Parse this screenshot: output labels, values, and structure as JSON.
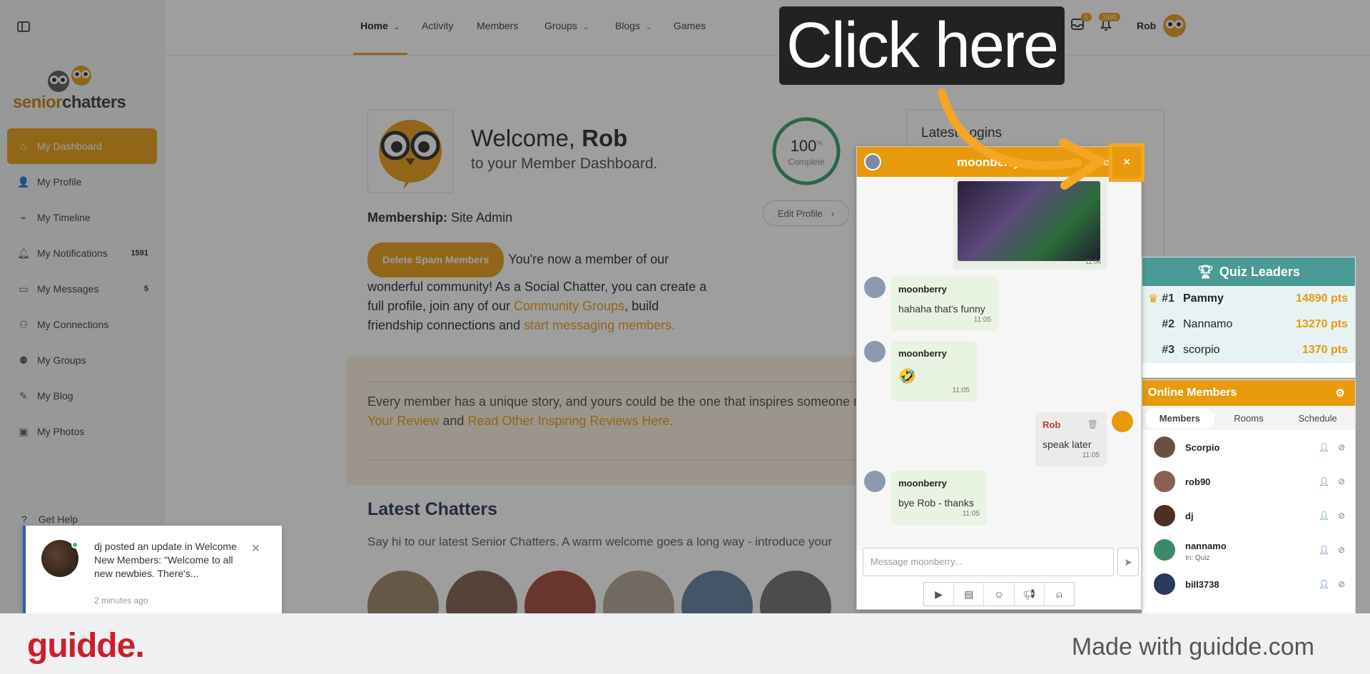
{
  "sidebar": {
    "brand_part1": "senior",
    "brand_part2": "chatters",
    "items": [
      {
        "label": "My Dashboard",
        "icon": "home-icon",
        "count": ""
      },
      {
        "label": "My Profile",
        "icon": "user-icon",
        "count": ""
      },
      {
        "label": "My Timeline",
        "icon": "timeline-icon",
        "count": ""
      },
      {
        "label": "My Notifications",
        "icon": "bell-icon",
        "count": "1591"
      },
      {
        "label": "My Messages",
        "icon": "inbox-icon",
        "count": "5"
      },
      {
        "label": "My Connections",
        "icon": "connections-icon",
        "count": ""
      },
      {
        "label": "My Groups",
        "icon": "groups-icon",
        "count": ""
      },
      {
        "label": "My Blog",
        "icon": "pencil-icon",
        "count": ""
      },
      {
        "label": "My Photos",
        "icon": "photos-icon",
        "count": ""
      }
    ],
    "help_label": "Get Help"
  },
  "topnav": {
    "items": [
      "Home",
      "Activity",
      "Members",
      "Groups",
      "Blogs",
      "Games"
    ],
    "messages_badge": "5",
    "notifications_badge": "1590",
    "user_name": "Rob"
  },
  "dashboard": {
    "welcome_prefix": "Welcome,",
    "welcome_name": "Rob",
    "welcome_sub": "to your Member Dashboard.",
    "membership_label": "Membership:",
    "membership_value": "Site Admin",
    "profile_complete_pct": "100",
    "profile_complete_label": "Complete",
    "edit_profile_label": "Edit Profile",
    "spam_button": "Delete Spam Members",
    "intro_1": "You're now a member of our wonderful community! As a Social Chatter, you can create a full profile, join any of our",
    "intro_link1": "Community Groups",
    "intro_2": ", build friendship connections and",
    "intro_link2": "start messaging members.",
    "review_1": "Every member has a unique story, and yours could be the one that inspires someone ne",
    "review_link1": "Your Review",
    "review_and": " and ",
    "review_link2": "Read Other Inspiring Reviews Here.",
    "latest_title": "Latest Chatters",
    "latest_sub": "Say hi to our latest Senior Chatters. A warm welcome goes a long way - introduce your",
    "logins_title": "Latest Logins"
  },
  "chat": {
    "contact": "moonberry",
    "image_time": "11:04",
    "messages": [
      {
        "from": "moonberry",
        "text": "hahaha that's funny",
        "time": "11:05"
      },
      {
        "from": "moonberry",
        "text": "🤣",
        "time": "11:05"
      },
      {
        "from": "Rob",
        "text": "speak later",
        "time": "11:05"
      },
      {
        "from": "moonberry",
        "text": "bye Rob - thanks",
        "time": "11:05"
      }
    ],
    "input_placeholder": "Message moonberry...",
    "close_label": "×"
  },
  "quiz": {
    "title": "Quiz Leaders",
    "leaders": [
      {
        "rank": "#1",
        "name": "Pammy",
        "pts": "14890 pts"
      },
      {
        "rank": "#2",
        "name": "Nannamo",
        "pts": "13270 pts"
      },
      {
        "rank": "#3",
        "name": "scorpio",
        "pts": "1370 pts"
      }
    ]
  },
  "online": {
    "title": "Online Members",
    "tabs": [
      "Members",
      "Rooms",
      "Schedule"
    ],
    "members": [
      {
        "name": "Scorpio",
        "sub": ""
      },
      {
        "name": "rob90",
        "sub": ""
      },
      {
        "name": "dj",
        "sub": ""
      },
      {
        "name": "nannamo",
        "sub": "In: Quiz"
      },
      {
        "name": "bill3738",
        "sub": ""
      }
    ]
  },
  "toast": {
    "text": "dj posted an update in Welcome New Members: \"Welcome to all new newbies. There's...",
    "time": "2 minutes ago"
  },
  "callout": {
    "text": "Click here"
  },
  "footer": {
    "logo": "guidde.",
    "made_with": "Made with guidde.com"
  },
  "colors": {
    "accent": "#e89a0c",
    "teal": "#4a9a96",
    "footer_brand": "#cc1f2e"
  }
}
